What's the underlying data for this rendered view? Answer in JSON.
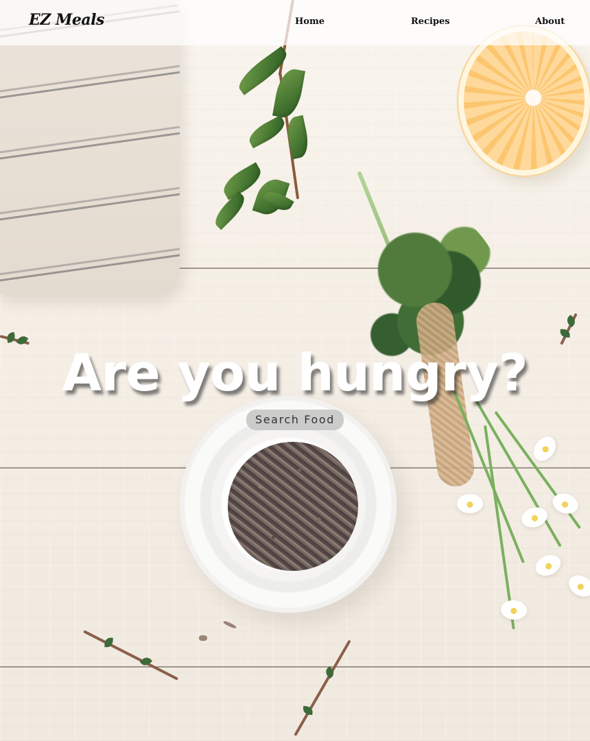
{
  "header": {
    "brand": "EZ Meals",
    "nav": [
      {
        "label": "Home"
      },
      {
        "label": "Recipes"
      },
      {
        "label": "About"
      }
    ]
  },
  "hero": {
    "title": "Are you hungry?",
    "cta_label": "Search Food"
  }
}
